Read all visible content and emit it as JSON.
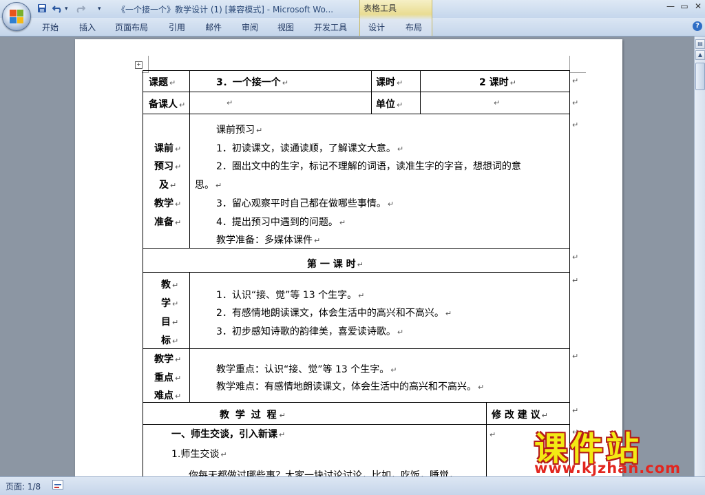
{
  "window": {
    "title": "《一个接一个》教学设计 (1) [兼容模式] - Microsoft Wo...",
    "context_tab_group": "表格工具",
    "controls": [
      "—",
      "▭",
      "✕"
    ]
  },
  "quick_access": [
    "save-icon",
    "undo-icon",
    "redo-icon",
    "customize-icon"
  ],
  "ribbon": {
    "tabs": [
      "开始",
      "插入",
      "页面布局",
      "引用",
      "邮件",
      "审阅",
      "视图",
      "开发工具",
      "设计",
      "布局"
    ],
    "help": "?"
  },
  "document": {
    "row1": {
      "label_topic": "课题",
      "topic": "3．一个接一个",
      "label_hours": "课时",
      "hours": "2 课时"
    },
    "row2": {
      "label_preparer": "备课人",
      "preparer": "",
      "label_unit": "单位",
      "unit": ""
    },
    "prep": {
      "label_lines": [
        "课前",
        "预习",
        "及",
        "教学",
        "准备"
      ],
      "heading": "课前预习",
      "items": [
        "1．初读课文，读通读顺，了解课文大意。",
        "2．圈出文中的生字，标记不理解的词语，读准生字的字音，想想词的意",
        "思。",
        "3．留心观察平时自己都在做哪些事情。",
        "4．提出预习中遇到的问题。"
      ],
      "prep_line": "教学准备：多媒体课件"
    },
    "lesson_heading": "第 一 课 时",
    "goals": {
      "label_lines": [
        "教",
        "学",
        "目",
        "标"
      ],
      "items": [
        "1．认识“接、觉”等 13 个生字。",
        "2．有感情地朗读课文，体会生活中的高兴和不高兴。",
        "3．初步感知诗歌的韵律美，喜爱读诗歌。"
      ]
    },
    "keypoints": {
      "label_lines": [
        "教学",
        "重点",
        "难点"
      ],
      "key": "教学重点：认识“接、觉”等 13 个生字。",
      "difficult": "教学难点：有感情地朗读课文，体会生活中的高兴和不高兴。"
    },
    "process_header": "教 学 过 程",
    "suggest_header": "修 改 建 议",
    "process": {
      "section1": "一、师生交谈，引入新课",
      "item1": "1.师生交谈",
      "para_partial": "你每天都做过哪些事？大家一块讨论讨论，比如，吃饭，睡觉，"
    }
  },
  "status": {
    "page": "页面: 1/8"
  },
  "watermark": {
    "brand": "课件站",
    "url": "www.kjzhan.com"
  },
  "colors": {
    "ribbon": "#c5d6ec",
    "workspace": "#8c96a3",
    "watermark_yellow": "#f3ea14",
    "watermark_red": "#e2261f"
  }
}
